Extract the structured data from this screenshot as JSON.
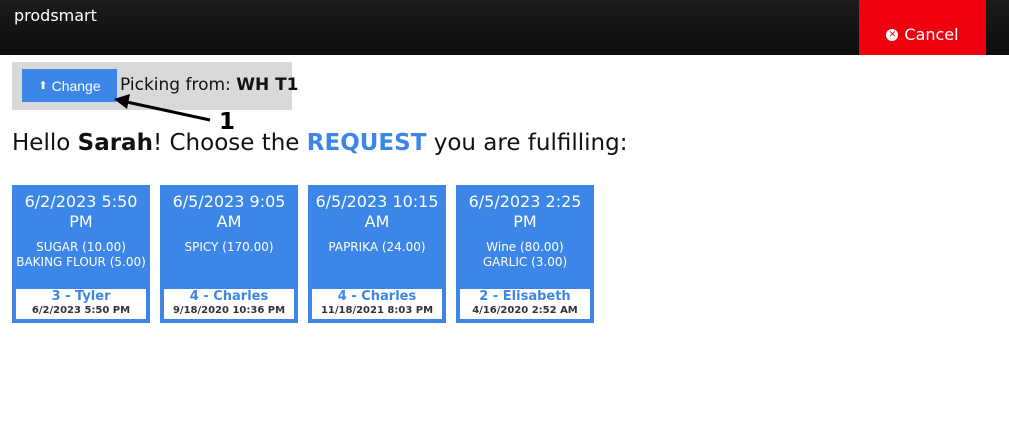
{
  "app": {
    "brand": "prodsmart"
  },
  "header": {
    "cancel_label": "Cancel",
    "cancel_icon": "times-circle-icon"
  },
  "picker": {
    "change_label": "Change",
    "change_icon": "upload-icon",
    "picking_prefix": "Picking from:",
    "warehouse": "WH T1"
  },
  "annotation": {
    "number": "1"
  },
  "greeting": {
    "prefix": "Hello",
    "user": "Sarah",
    "middle": "! Choose the",
    "highlight": "REQUEST",
    "suffix": "you are fulfilling:"
  },
  "requests": [
    {
      "date": "6/2/2023 5:50 PM",
      "items": [
        "SUGAR (10.00)",
        "BAKING FLOUR (5.00)"
      ],
      "requester": "3 - Tyler",
      "created": "6/2/2023 5:50 PM"
    },
    {
      "date": "6/5/2023 9:05 AM",
      "items": [
        "SPICY (170.00)"
      ],
      "requester": "4 - Charles",
      "created": "9/18/2020 10:36 PM"
    },
    {
      "date": "6/5/2023 10:15 AM",
      "items": [
        "PAPRIKA (24.00)"
      ],
      "requester": "4 - Charles",
      "created": "11/18/2021 8:03 PM"
    },
    {
      "date": "6/5/2023 2:25 PM",
      "items": [
        "Wine (80.00)",
        "GARLIC (3.00)"
      ],
      "requester": "2 - Elisabeth",
      "created": "4/16/2020 2:52 AM"
    }
  ],
  "colors": {
    "accent": "#3c86e8",
    "cancel": "#f0000f",
    "topbar": "#111111",
    "picker_bg": "#d9d9d9"
  }
}
